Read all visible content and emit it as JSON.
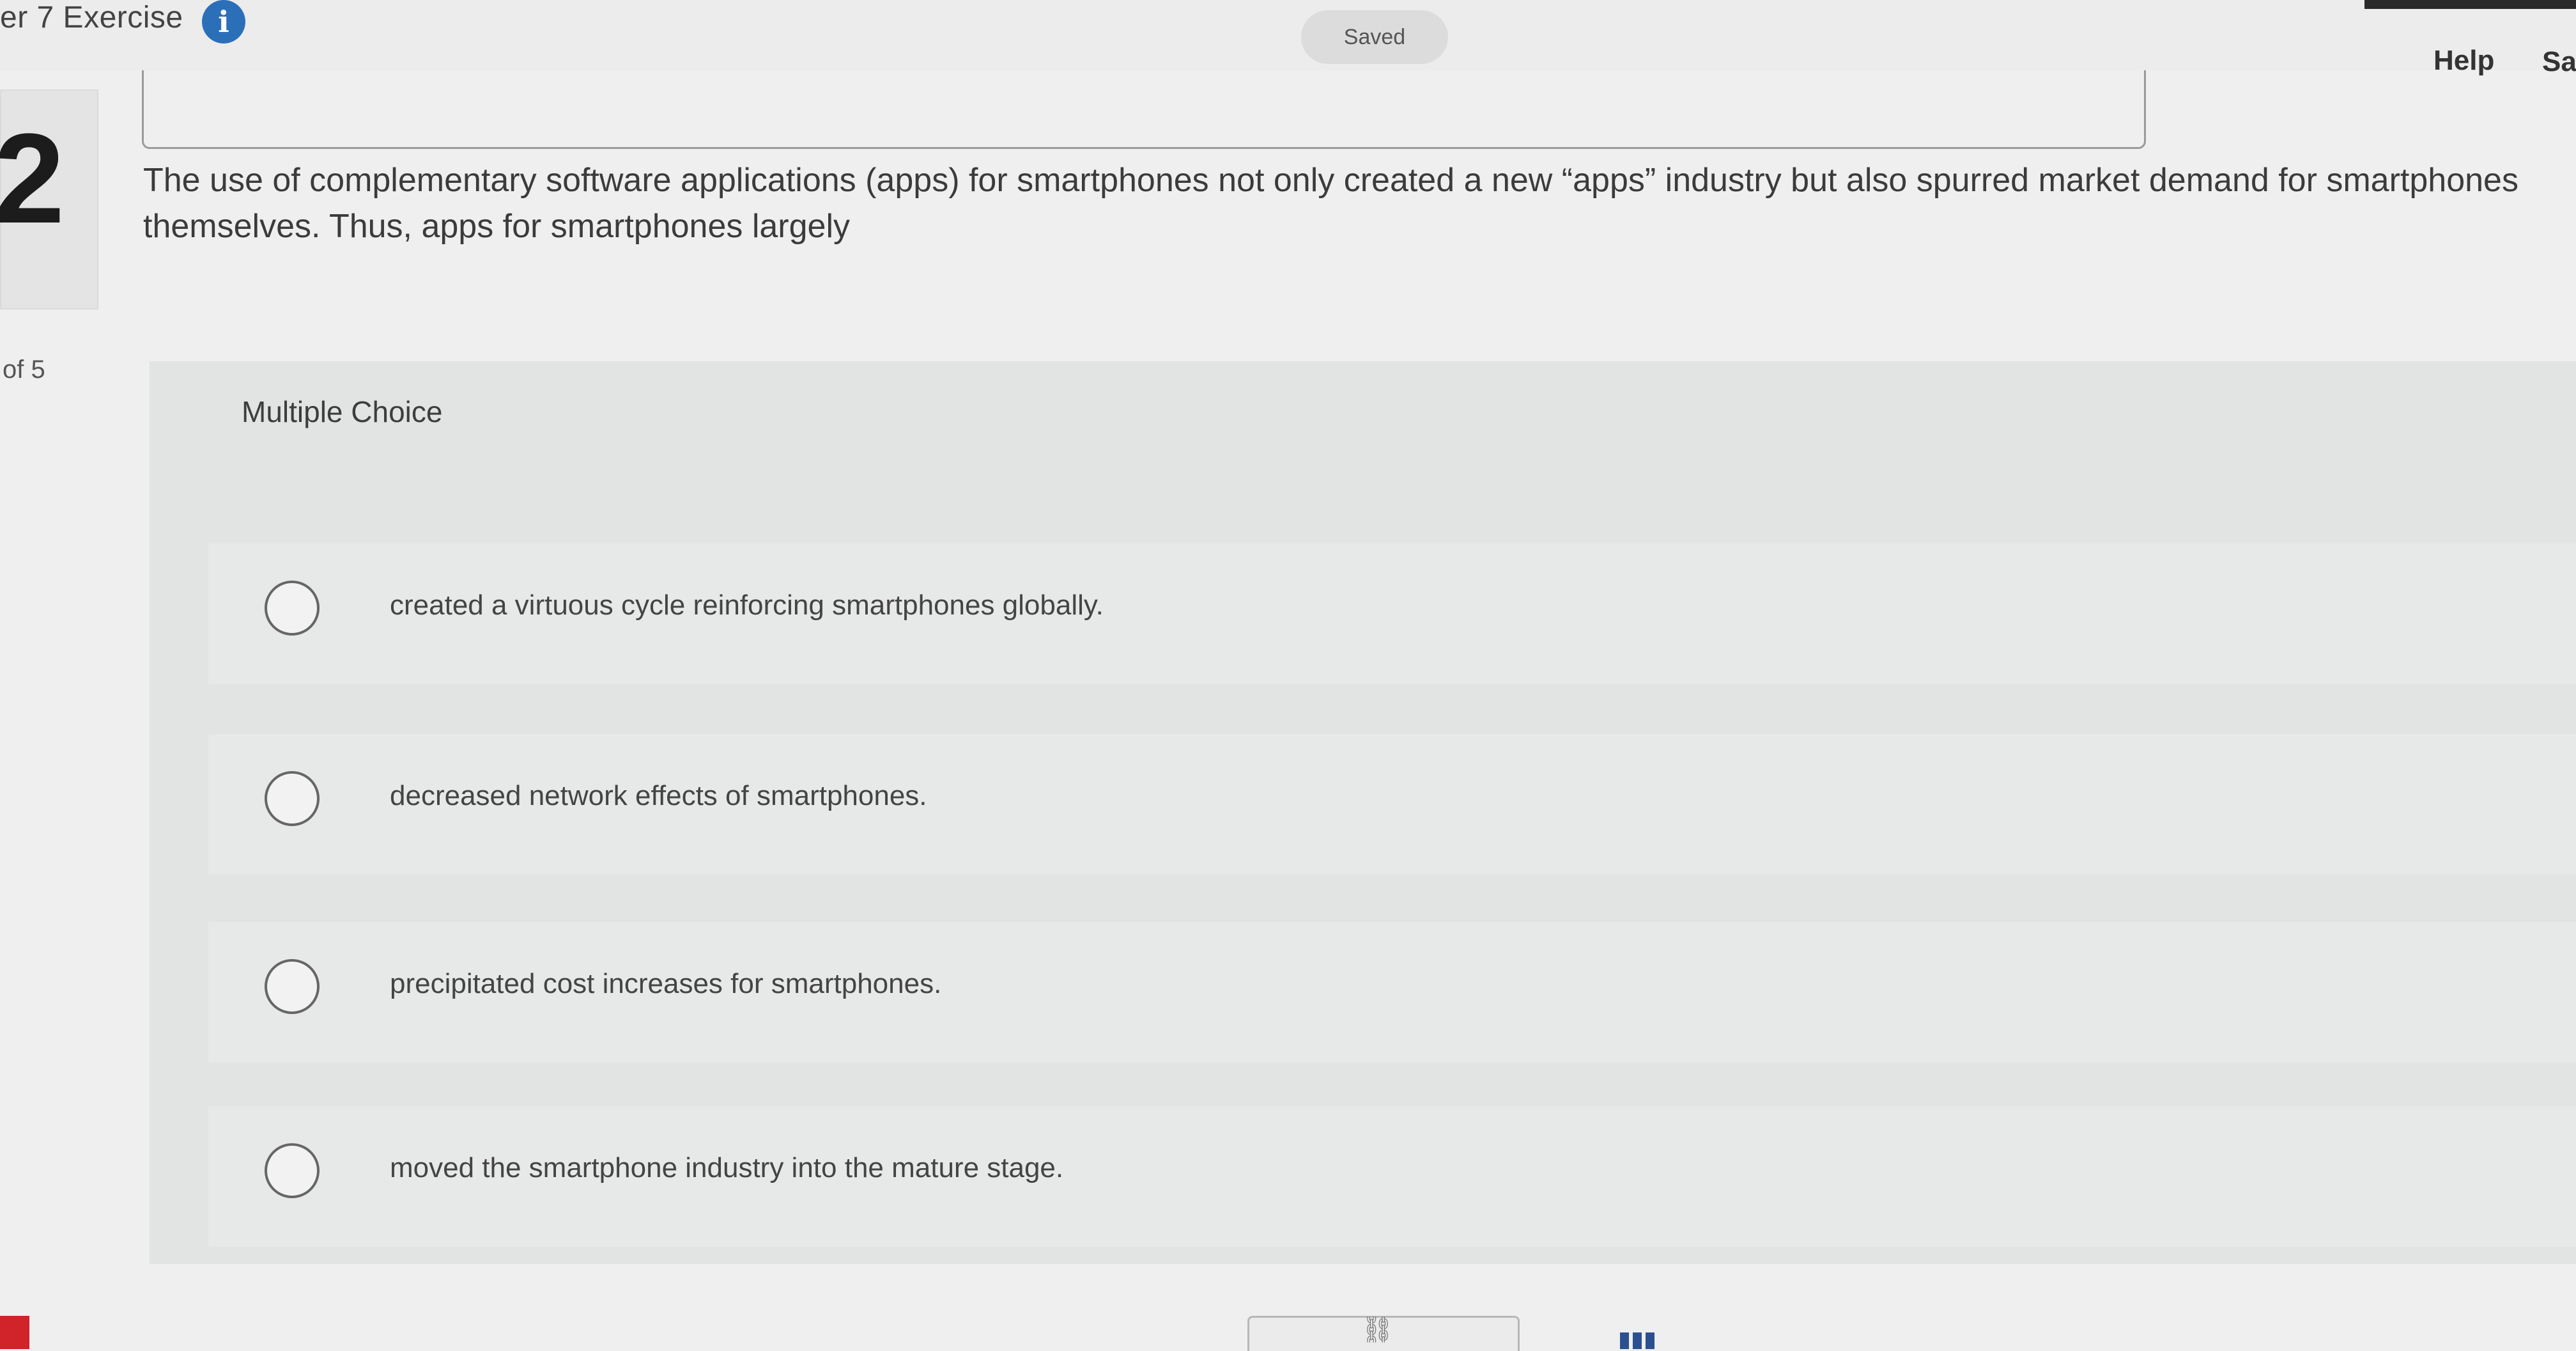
{
  "header": {
    "title": "er 7 Exercise",
    "info_icon": "i",
    "saved": "Saved",
    "help": "Help",
    "save": "Sa"
  },
  "left_rail": {
    "question_number": "2",
    "page_counter": "of 5"
  },
  "question": {
    "text": "The use of complementary software applications (apps) for smartphones not only created a new “apps” industry but also spurred market demand for smartphones themselves. Thus, apps for smartphones largely"
  },
  "multiple_choice": {
    "label": "Multiple Choice",
    "options": [
      "created a virtuous cycle reinforcing smartphones globally.",
      "decreased network effects of smartphones.",
      "precipitated cost increases for smartphones.",
      "moved the smartphone industry into the mature stage."
    ]
  },
  "icons": {
    "link": "⛓",
    "info": "info-icon",
    "grid": "grid-icon"
  },
  "colors": {
    "info_blue": "#2c6fb9",
    "accent_red": "#d0232a"
  }
}
